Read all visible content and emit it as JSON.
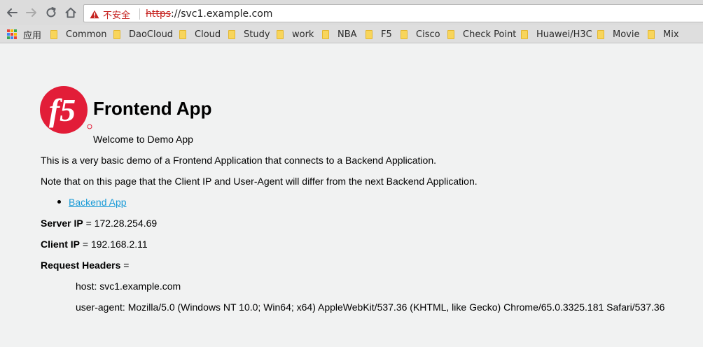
{
  "browser": {
    "security_text": "不安全",
    "url_scheme": "https",
    "url_rest": "://svc1.example.com",
    "bookmarks": {
      "apps": "应用",
      "items": [
        "Common",
        "DaoCloud",
        "Cloud",
        "Study",
        "work",
        "NBA",
        "F5",
        "Cisco",
        "Check Point",
        "Huawei/H3C",
        "Movie",
        "Mix"
      ]
    }
  },
  "page": {
    "logo_text": "f5",
    "title": "Frontend App",
    "welcome": "Welcome to Demo App",
    "intro": "This is a very basic demo of a Frontend Application that connects to a Backend Application.",
    "note": "Note that on this page that the Client IP and User-Agent will differ from the next Backend Application.",
    "backend_link": "Backend App",
    "server_ip_label": "Server IP",
    "server_ip_value": " = 172.28.254.69",
    "client_ip_label": "Client IP",
    "client_ip_value": " = 192.168.2.11",
    "headers_label": "Request Headers",
    "headers_eq": " =",
    "header_host": "host: svc1.example.com",
    "header_user_agent": "user-agent: Mozilla/5.0 (Windows NT 10.0; Win64; x64) AppleWebKit/537.36 (KHTML, like Gecko) Chrome/65.0.3325.181 Safari/537.36"
  },
  "colors": {
    "f5_red": "#e21d38",
    "link": "#1a9bd7",
    "insecure": "#c5221f",
    "folder": "#f8d55b"
  },
  "icons": [
    "back-arrow-icon",
    "forward-arrow-icon",
    "reload-icon",
    "home-icon",
    "warning-icon",
    "apps-grid-icon",
    "folder-icon",
    "f5-logo"
  ]
}
